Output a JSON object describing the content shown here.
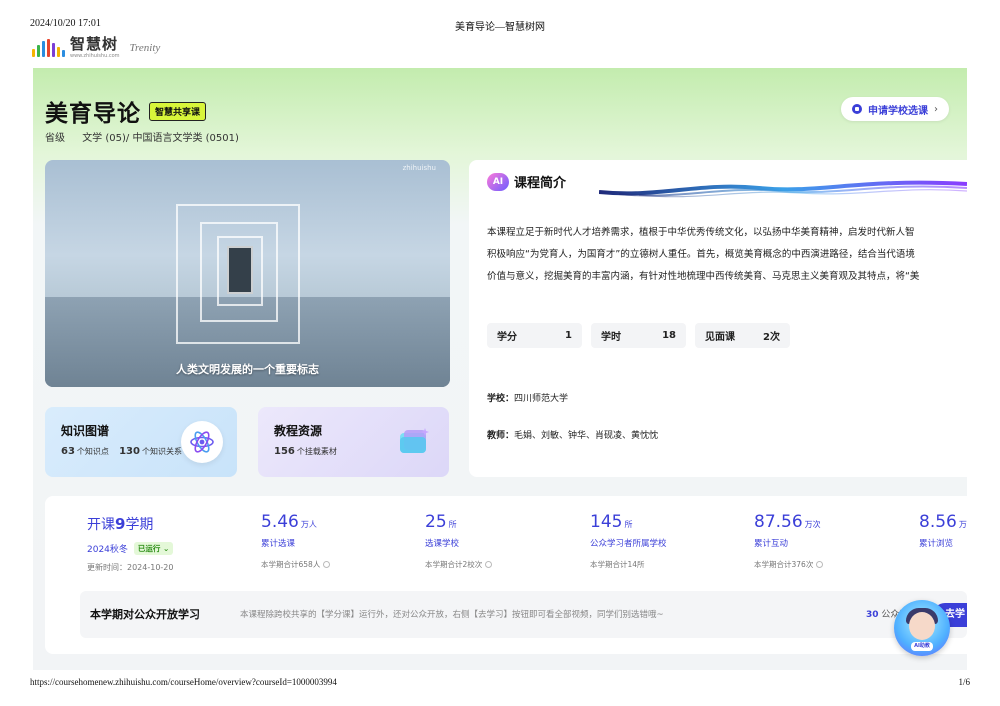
{
  "print": {
    "datetime": "2024/10/20 17:01",
    "title": "美育导论—智慧树网",
    "url": "https://coursehomenew.zhihuishu.com/courseHome/overview?courseId=1000003994",
    "page": "1/6"
  },
  "logo": {
    "name": "智慧树",
    "sub": "www.zhihuishu.com",
    "partner": "Trenity",
    "bar_colors": [
      "#f6b400",
      "#3bb44a",
      "#2b8de0",
      "#e8442e",
      "#7b3fd6",
      "#f6b400",
      "#2b8de0"
    ]
  },
  "course": {
    "title": "美育导论",
    "badge": "智慧共享课",
    "level": "省级",
    "category": "文学 (05)/ 中国语言文学类 (0501)",
    "apply_button": "申请学校选课",
    "apply_chevron": "›"
  },
  "video": {
    "caption": "人类文明发展的一个重要标志",
    "watermark": "zhihuishu"
  },
  "cards": [
    {
      "title": "知识图谱",
      "stat1_num": "63",
      "stat1_label": "个知识点",
      "stat2_num": "130",
      "stat2_label": "个知识关系",
      "icon": "atom-icon"
    },
    {
      "title": "教程资源",
      "stat1_num": "156",
      "stat1_label": "个挂载素材",
      "icon": "folder-icon"
    }
  ],
  "intro": {
    "ai_label": "AI",
    "title": "课程简介",
    "lines": [
      "本课程立足于新时代人才培养需求，植根于中华优秀传统文化，以弘扬中华美育精神，启发时代新人智",
      "积极响应“为党育人，为国育才”的立德树人重任。首先，概览美育概念的中西演进路径，结合当代语境",
      "价值与意义，挖掘美育的丰富内涵，有针对性地梳理中西传统美育、马克思主义美育观及其特点，将“美"
    ],
    "stats": [
      {
        "label": "学分",
        "value": "1"
      },
      {
        "label": "学时",
        "value": "18"
      },
      {
        "label": "见面课",
        "value": "2次"
      }
    ],
    "school_label": "学校：",
    "school": "四川师范大学",
    "teachers_label": "教师：",
    "teachers": "毛娟、刘敏、钟华、肖砚凌、黄忱忱"
  },
  "semester": {
    "prefix": "开课",
    "num": "9",
    "suffix": "学期",
    "term": "2024秋冬",
    "status": "已运行 ⌄",
    "updated": "更新时间：2024-10-20"
  },
  "metrics": [
    {
      "num": "5.46",
      "unit": "万人",
      "label": "累计选课",
      "sub": "本学期合计658人"
    },
    {
      "num": "25",
      "unit": "所",
      "label": "选课学校",
      "sub": "本学期合计2校次"
    },
    {
      "num": "145",
      "unit": "所",
      "label": "公众学习者所属学校",
      "sub": "本学期合计14所"
    },
    {
      "num": "87.56",
      "unit": "万次",
      "label": "累计互动",
      "sub": "本学期合计376次"
    },
    {
      "num": "8.56",
      "unit": "万",
      "label": "累计浏览",
      "sub": ""
    }
  ],
  "open": {
    "title": "本学期对公众开放学习",
    "desc": "本课程除跨校共享的【学分课】运行外，还对公众开放，右侧【去学习】按钮即可看全部视频，同学们别选错哦~",
    "count_num": "30",
    "count_label": "公众已",
    "button": "去学"
  },
  "assistant": {
    "label": "AI助教"
  }
}
